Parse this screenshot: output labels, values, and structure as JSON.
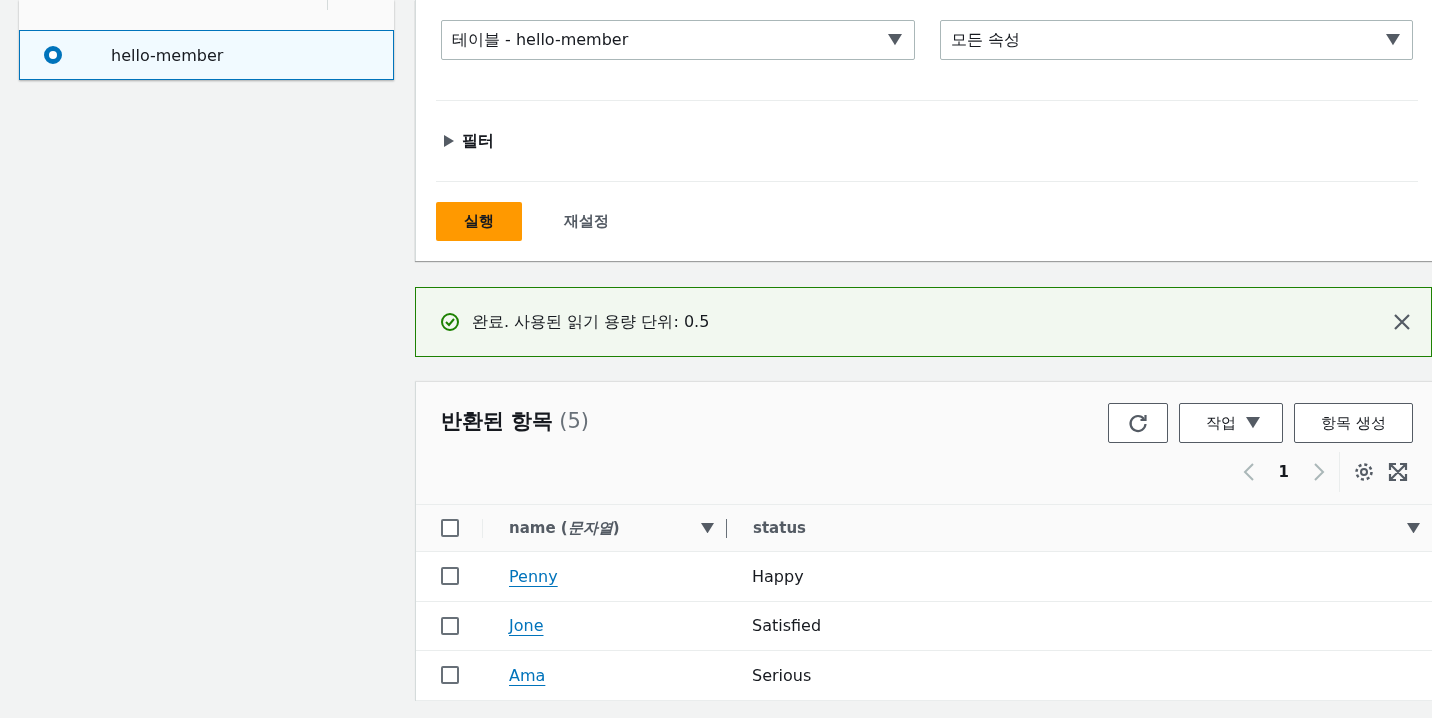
{
  "table_list": {
    "items": [
      {
        "label": "hello-member",
        "selected": true
      }
    ]
  },
  "query": {
    "table_select": {
      "value": "테이블 - hello-member"
    },
    "projection_select": {
      "value": "모든 속성"
    },
    "filter": {
      "label": "필터",
      "expanded": false
    },
    "run_button": "실행",
    "reset_button": "재설정"
  },
  "flash": {
    "message": "완료. 사용된 읽기 용량 단위: 0.5"
  },
  "results": {
    "title": "반환된 항목",
    "count": "(5)",
    "actions_button": "작업",
    "create_button": "항목 생성",
    "page": "1",
    "select_all": {
      "checked": false
    },
    "columns": [
      {
        "label": "name **(*문자열*)**"
      },
      {
        "label": "status"
      }
    ],
    "rows": [
      {
        "name": "Penny",
        "status": "Happy",
        "checked": false
      },
      {
        "name": "Jone",
        "status": "Satisfied",
        "checked": false
      },
      {
        "name": "Ama",
        "status": "Serious",
        "checked": false
      }
    ]
  }
}
